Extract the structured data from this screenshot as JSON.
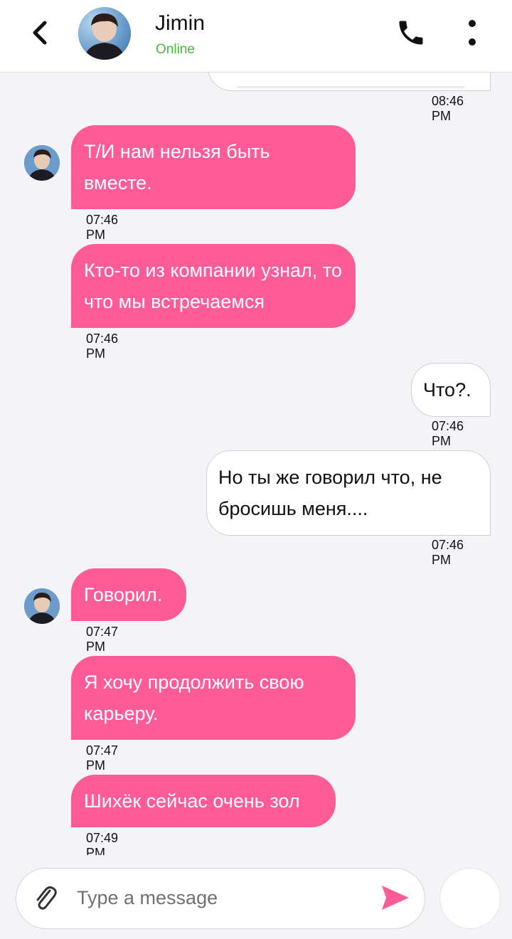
{
  "header": {
    "contact_name": "Jimin",
    "status": "Online",
    "status_color": "#44b93d",
    "icons": [
      "back-arrow-icon",
      "phone-icon",
      "more-vertical-icon"
    ]
  },
  "theme": {
    "incoming_bubble": "#ff5c97",
    "outgoing_bubble": "#ffffff",
    "accent": "#ff5c97"
  },
  "messages": [
    {
      "direction": "out",
      "text": "",
      "time": "08:46 PM"
    },
    {
      "direction": "in",
      "text": "Т/И нам нельзя быть вместе.",
      "time": "07:46 PM"
    },
    {
      "direction": "in",
      "text": "Кто-то из компании узнал, то что мы встречаемся",
      "time": "07:46 PM"
    },
    {
      "direction": "out",
      "text": "Что?.",
      "time": "07:46 PM"
    },
    {
      "direction": "out",
      "text": "Но ты же говорил что, не бросишь меня....",
      "time": "07:46 PM"
    },
    {
      "direction": "in",
      "text": "Говорил.",
      "time": "07:47 PM"
    },
    {
      "direction": "in",
      "text": "Я хочу продолжить свою карьеру.",
      "time": "07:47 PM"
    },
    {
      "direction": "in",
      "text": "Шихёк сейчас очень зол",
      "time": "07:49 PM"
    }
  ],
  "composer": {
    "placeholder": "Type a message",
    "icons": [
      "paperclip-icon",
      "send-icon"
    ]
  }
}
